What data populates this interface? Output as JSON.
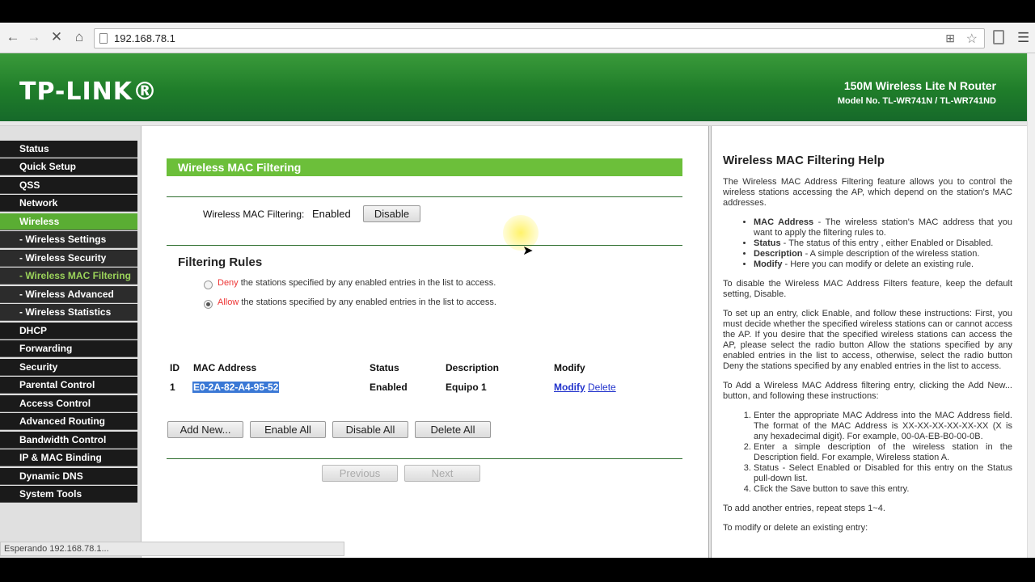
{
  "browser": {
    "url": "192.168.78.1",
    "status_text": "Esperando 192.168.78.1..."
  },
  "banner": {
    "logo": "TP-LINK®",
    "model_title": "150M Wireless Lite N Router",
    "model_no": "Model No. TL-WR741N / TL-WR741ND"
  },
  "sidebar": {
    "items": [
      {
        "label": "Status"
      },
      {
        "label": "Quick Setup"
      },
      {
        "label": "QSS"
      },
      {
        "label": "Network"
      },
      {
        "label": "Wireless"
      },
      {
        "label": "- Wireless Settings"
      },
      {
        "label": "- Wireless Security"
      },
      {
        "label": "- Wireless MAC Filtering"
      },
      {
        "label": "- Wireless Advanced"
      },
      {
        "label": "- Wireless Statistics"
      },
      {
        "label": "DHCP"
      },
      {
        "label": "Forwarding"
      },
      {
        "label": "Security"
      },
      {
        "label": "Parental Control"
      },
      {
        "label": "Access Control"
      },
      {
        "label": "Advanced Routing"
      },
      {
        "label": "Bandwidth Control"
      },
      {
        "label": "IP & MAC Binding"
      },
      {
        "label": "Dynamic DNS"
      },
      {
        "label": "System Tools"
      }
    ]
  },
  "main": {
    "title": "Wireless MAC Filtering",
    "filter_label": "Wireless MAC Filtering:",
    "filter_state": "Enabled",
    "disable_button": "Disable",
    "rules_title": "Filtering Rules",
    "deny_word": "Deny",
    "deny_text": "the stations specified by any enabled entries in the list to access.",
    "allow_word": "Allow",
    "allow_text": "the stations specified by any enabled entries in the list to access.",
    "table": {
      "headers": [
        "ID",
        "MAC Address",
        "Status",
        "Description",
        "Modify"
      ],
      "rows": [
        {
          "id": "1",
          "mac": "E0-2A-82-A4-95-52",
          "status": "Enabled",
          "description": "Equipo 1",
          "modify": "Modify",
          "delete": "Delete"
        }
      ]
    },
    "buttons": {
      "add_new": "Add New...",
      "enable_all": "Enable All",
      "disable_all": "Disable All",
      "delete_all": "Delete All",
      "previous": "Previous",
      "next": "Next"
    }
  },
  "help": {
    "title": "Wireless MAC Filtering Help",
    "intro": "The Wireless MAC Address Filtering feature allows you to control the wireless stations accessing the AP, which depend on the station's MAC addresses.",
    "bullets": [
      {
        "term": "MAC Address",
        "text": " - The wireless station's MAC address that you want to apply the filtering rules to."
      },
      {
        "term": "Status",
        "text": " - The status of this entry , either Enabled or Disabled."
      },
      {
        "term": "Description",
        "text": " - A simple description of the wireless station."
      },
      {
        "term": "Modify",
        "text": " - Here you can modify or delete an existing rule."
      }
    ],
    "disable_note": "To disable the Wireless MAC Address Filters feature, keep the default setting, Disable.",
    "setup_note": "To set up an entry, click Enable, and follow these instructions: First, you must decide whether the specified wireless stations can or cannot access the AP. If you desire that the specified wireless stations can access the AP, please select the radio button Allow the stations specified by any enabled entries in the list to access, otherwise, select the radio button Deny the stations specified by any enabled entries in the list to access.",
    "add_note": "To Add a Wireless MAC Address filtering entry, clicking the Add New... button, and following these instructions:",
    "steps": [
      "Enter the appropriate MAC Address into the MAC Address field. The format of the MAC Address is XX-XX-XX-XX-XX-XX (X is any hexadecimal digit). For example, 00-0A-EB-B0-00-0B.",
      "Enter a simple description of the wireless station in the Description field. For example, Wireless station A.",
      "Status - Select Enabled or Disabled for this entry on the Status pull-down list.",
      "Click the Save button to save this entry."
    ],
    "repeat_note": "To add another entries, repeat steps 1~4.",
    "modify_note": "To modify or delete an existing entry:"
  }
}
